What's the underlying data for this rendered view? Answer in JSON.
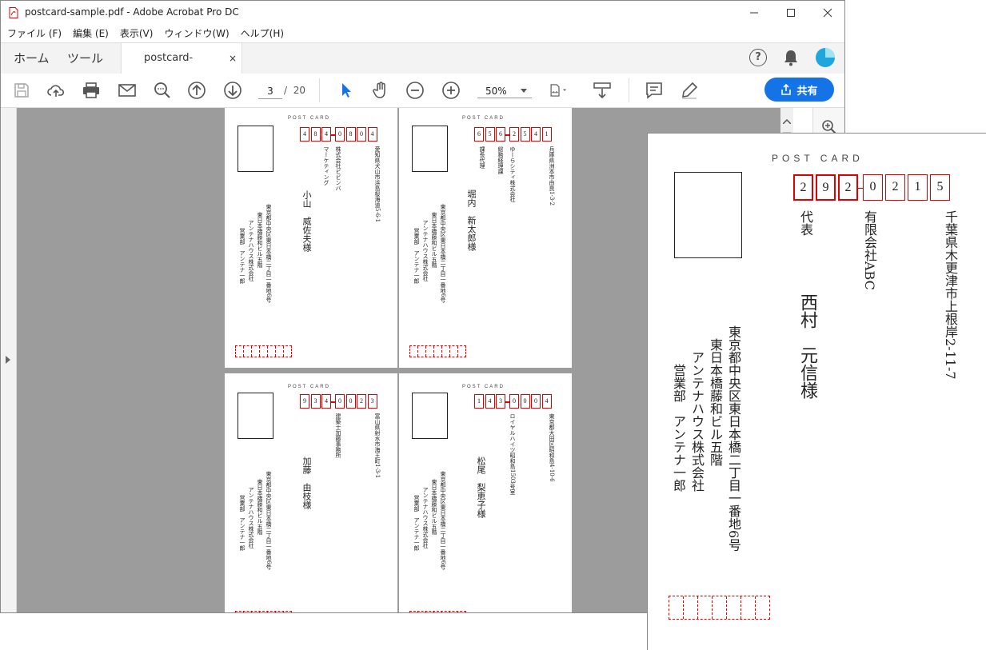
{
  "window": {
    "title": "postcard-sample.pdf - Adobe Acrobat Pro DC",
    "menu": [
      "ファイル (F)",
      "編集 (E)",
      "表示(V)",
      "ウィンドウ(W)",
      "ヘルプ(H)"
    ],
    "tabs": {
      "home": "ホーム",
      "tools": "ツール",
      "doc": "postcard-sample.pdf",
      "close": "×"
    },
    "toolbar": {
      "page_current": "3",
      "page_sep": "/",
      "page_total": "20",
      "zoom": "50%",
      "share_label": "共有"
    }
  },
  "postcard_label": "POST CARD",
  "cards": [
    {
      "zip": [
        "4",
        "8",
        "4",
        "0",
        "8",
        "0",
        "4"
      ],
      "address": "愛知県犬山市浜島桜海道5-6-1",
      "company": "株式会社ビビンバ",
      "dept": "マーケティング",
      "name": "小山　威佐夫様",
      "sender": [
        "東京都中央区東日本橋二丁目一番地6号",
        "東日本橋藤和ビル五階",
        "アンテナハウス株式会社",
        "営業部　アンテナ一郎"
      ]
    },
    {
      "zip": [
        "6",
        "5",
        "6",
        "2",
        "5",
        "4",
        "1"
      ],
      "address": "兵庫県洲本市由良1-3-2",
      "company": "ゆーらシティ株式会社",
      "dept": "総務経理課",
      "title": "課長代理",
      "name": "堀内　新太郎様",
      "sender": [
        "東京都中央区東日本橋二丁目一番地6号",
        "東日本橋藤和ビル五階",
        "アンテナハウス株式会社",
        "営業部　アンテナ一郎"
      ]
    },
    {
      "zip": [
        "9",
        "3",
        "4",
        "0",
        "0",
        "2",
        "3"
      ],
      "address": "富山県射水市海王町1-3-1",
      "company": "建築士加藤事務所",
      "name": "加藤　由枝様",
      "sender": [
        "東京都中央区東日本橋二丁目一番地6号",
        "東日本橋藤和ビル五階",
        "アンテナハウス株式会社",
        "営業部　アンテナ一郎"
      ]
    },
    {
      "zip": [
        "1",
        "4",
        "3",
        "0",
        "0",
        "0",
        "4"
      ],
      "address": "東京都大田区昭和島4-10-6",
      "company": "ロイヤルハイツ昭和島1503号室",
      "name": "松尾　梨恵子様",
      "sender": [
        "東京都中央区東日本橋二丁目一番地6号",
        "東日本橋藤和ビル五階",
        "アンテナハウス株式会社",
        "営業部　アンテナ一郎"
      ]
    }
  ],
  "zoomed_card": {
    "zip": [
      "2",
      "9",
      "2",
      "0",
      "2",
      "1",
      "5"
    ],
    "address": "千葉県木更津市上根岸2-11-7",
    "company": "有限会社ABC",
    "title": "代表",
    "name": "西村　元信様",
    "sender": [
      "東京都中央区東日本橋二丁目一番地6号",
      "東日本橋藤和ビル五階",
      "アンテナハウス株式会社",
      "営業部　アンテナ一郎"
    ]
  },
  "colors": {
    "accent": "#1473e6",
    "zip_red": "#e00000",
    "canvas": "#9c9c9c"
  }
}
